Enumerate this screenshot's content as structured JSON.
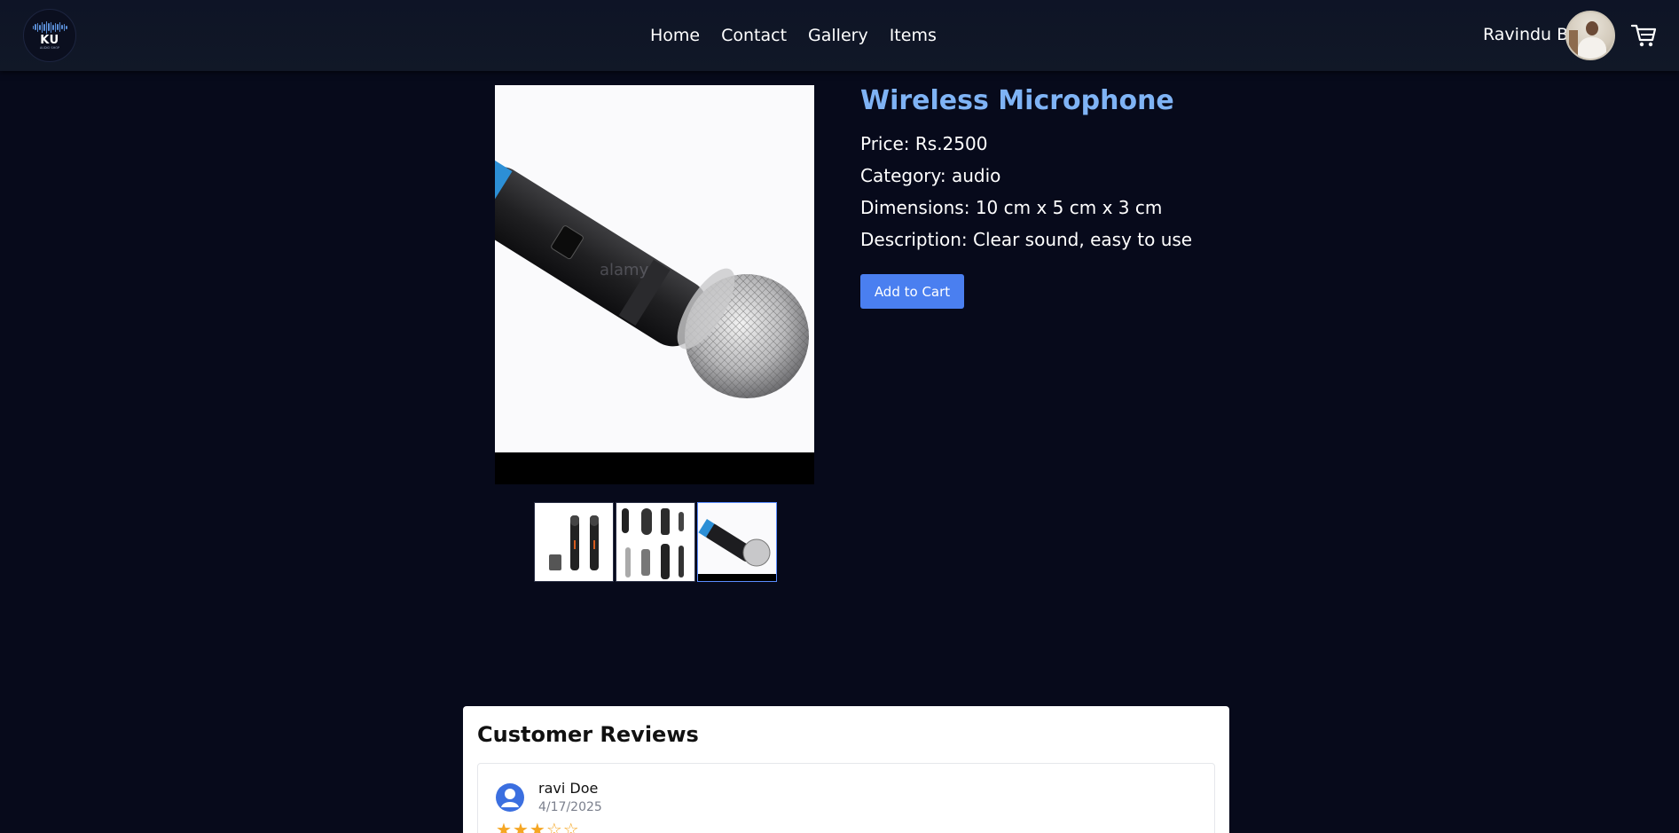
{
  "header": {
    "logo_text": "KU",
    "logo_subtext": "AUDIO SHOP",
    "nav": [
      {
        "label": "Home"
      },
      {
        "label": "Contact"
      },
      {
        "label": "Gallery"
      },
      {
        "label": "Items"
      }
    ],
    "user_name": "Ravindu B",
    "icons": {
      "cart": "cart-icon",
      "avatar": "user-avatar"
    }
  },
  "product": {
    "title": "Wireless Microphone",
    "price": "Price: Rs.2500",
    "category": "Category: audio",
    "dimensions": "Dimensions: 10 cm x 5 cm x 3 cm",
    "description": "Description: Clear sound, easy to use",
    "add_to_cart": "Add to Cart",
    "watermark": "alamy",
    "thumbnails_count": 3,
    "active_thumbnail": 3
  },
  "reviews": {
    "title": "Customer Reviews",
    "items": [
      {
        "name": "ravi Doe",
        "date": "4/17/2025",
        "rating": 3,
        "max_rating": 5
      }
    ]
  },
  "colors": {
    "background": "#070a1b",
    "header": "#111827",
    "title_accent": "#7fb3f5",
    "button": "#4a7ff0",
    "star": "#f5a623"
  }
}
